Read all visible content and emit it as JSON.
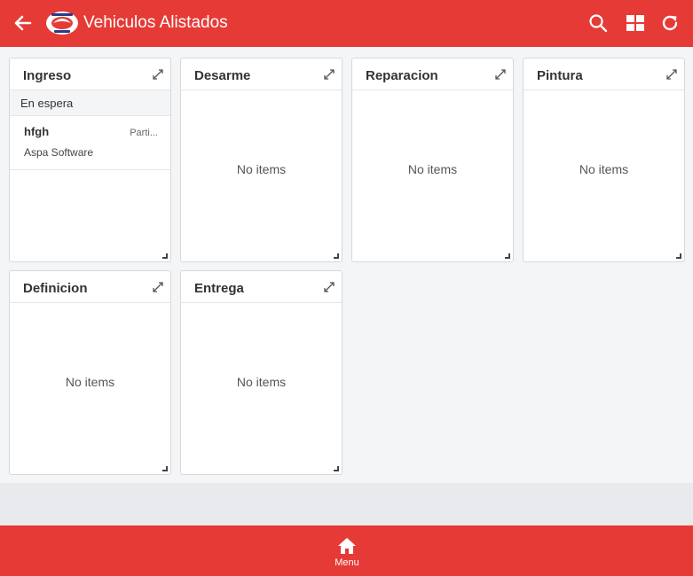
{
  "header": {
    "title": "Vehiculos Alistados",
    "back_icon": "back-arrow-icon",
    "logo": "brand-logo",
    "actions": [
      "search-icon",
      "grid-view-icon",
      "refresh-icon"
    ]
  },
  "columns": [
    {
      "title": "Ingreso",
      "group_label": "En espera",
      "cards": [
        {
          "title": "hfgh",
          "meta": "Parti...",
          "subtitle": "Aspa Software"
        }
      ]
    },
    {
      "title": "Desarme",
      "empty_text": "No items"
    },
    {
      "title": "Reparacion",
      "empty_text": "No items"
    },
    {
      "title": "Pintura",
      "empty_text": "No items"
    },
    {
      "title": "Definicion",
      "empty_text": "No items"
    },
    {
      "title": "Entrega",
      "empty_text": "No items"
    }
  ],
  "footer": {
    "menu_label": "Menu",
    "menu_icon": "home-icon"
  },
  "colors": {
    "primary": "#e63a36",
    "background": "#f4f5f7",
    "card": "#ffffff"
  }
}
